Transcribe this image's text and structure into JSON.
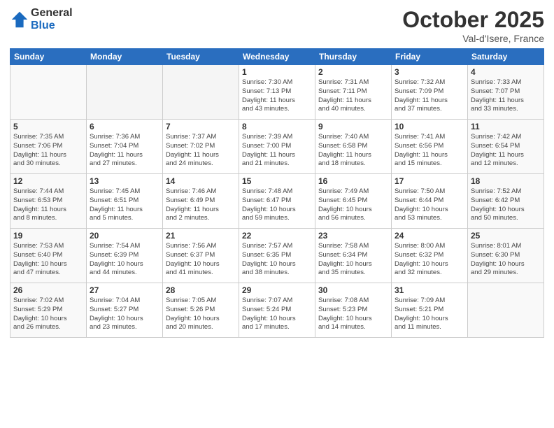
{
  "header": {
    "logo_general": "General",
    "logo_blue": "Blue",
    "month_title": "October 2025",
    "location": "Val-d'Isere, France"
  },
  "weekdays": [
    "Sunday",
    "Monday",
    "Tuesday",
    "Wednesday",
    "Thursday",
    "Friday",
    "Saturday"
  ],
  "weeks": [
    [
      {
        "day": "",
        "info": ""
      },
      {
        "day": "",
        "info": ""
      },
      {
        "day": "",
        "info": ""
      },
      {
        "day": "1",
        "info": "Sunrise: 7:30 AM\nSunset: 7:13 PM\nDaylight: 11 hours\nand 43 minutes."
      },
      {
        "day": "2",
        "info": "Sunrise: 7:31 AM\nSunset: 7:11 PM\nDaylight: 11 hours\nand 40 minutes."
      },
      {
        "day": "3",
        "info": "Sunrise: 7:32 AM\nSunset: 7:09 PM\nDaylight: 11 hours\nand 37 minutes."
      },
      {
        "day": "4",
        "info": "Sunrise: 7:33 AM\nSunset: 7:07 PM\nDaylight: 11 hours\nand 33 minutes."
      }
    ],
    [
      {
        "day": "5",
        "info": "Sunrise: 7:35 AM\nSunset: 7:06 PM\nDaylight: 11 hours\nand 30 minutes."
      },
      {
        "day": "6",
        "info": "Sunrise: 7:36 AM\nSunset: 7:04 PM\nDaylight: 11 hours\nand 27 minutes."
      },
      {
        "day": "7",
        "info": "Sunrise: 7:37 AM\nSunset: 7:02 PM\nDaylight: 11 hours\nand 24 minutes."
      },
      {
        "day": "8",
        "info": "Sunrise: 7:39 AM\nSunset: 7:00 PM\nDaylight: 11 hours\nand 21 minutes."
      },
      {
        "day": "9",
        "info": "Sunrise: 7:40 AM\nSunset: 6:58 PM\nDaylight: 11 hours\nand 18 minutes."
      },
      {
        "day": "10",
        "info": "Sunrise: 7:41 AM\nSunset: 6:56 PM\nDaylight: 11 hours\nand 15 minutes."
      },
      {
        "day": "11",
        "info": "Sunrise: 7:42 AM\nSunset: 6:54 PM\nDaylight: 11 hours\nand 12 minutes."
      }
    ],
    [
      {
        "day": "12",
        "info": "Sunrise: 7:44 AM\nSunset: 6:53 PM\nDaylight: 11 hours\nand 8 minutes."
      },
      {
        "day": "13",
        "info": "Sunrise: 7:45 AM\nSunset: 6:51 PM\nDaylight: 11 hours\nand 5 minutes."
      },
      {
        "day": "14",
        "info": "Sunrise: 7:46 AM\nSunset: 6:49 PM\nDaylight: 11 hours\nand 2 minutes."
      },
      {
        "day": "15",
        "info": "Sunrise: 7:48 AM\nSunset: 6:47 PM\nDaylight: 10 hours\nand 59 minutes."
      },
      {
        "day": "16",
        "info": "Sunrise: 7:49 AM\nSunset: 6:45 PM\nDaylight: 10 hours\nand 56 minutes."
      },
      {
        "day": "17",
        "info": "Sunrise: 7:50 AM\nSunset: 6:44 PM\nDaylight: 10 hours\nand 53 minutes."
      },
      {
        "day": "18",
        "info": "Sunrise: 7:52 AM\nSunset: 6:42 PM\nDaylight: 10 hours\nand 50 minutes."
      }
    ],
    [
      {
        "day": "19",
        "info": "Sunrise: 7:53 AM\nSunset: 6:40 PM\nDaylight: 10 hours\nand 47 minutes."
      },
      {
        "day": "20",
        "info": "Sunrise: 7:54 AM\nSunset: 6:39 PM\nDaylight: 10 hours\nand 44 minutes."
      },
      {
        "day": "21",
        "info": "Sunrise: 7:56 AM\nSunset: 6:37 PM\nDaylight: 10 hours\nand 41 minutes."
      },
      {
        "day": "22",
        "info": "Sunrise: 7:57 AM\nSunset: 6:35 PM\nDaylight: 10 hours\nand 38 minutes."
      },
      {
        "day": "23",
        "info": "Sunrise: 7:58 AM\nSunset: 6:34 PM\nDaylight: 10 hours\nand 35 minutes."
      },
      {
        "day": "24",
        "info": "Sunrise: 8:00 AM\nSunset: 6:32 PM\nDaylight: 10 hours\nand 32 minutes."
      },
      {
        "day": "25",
        "info": "Sunrise: 8:01 AM\nSunset: 6:30 PM\nDaylight: 10 hours\nand 29 minutes."
      }
    ],
    [
      {
        "day": "26",
        "info": "Sunrise: 7:02 AM\nSunset: 5:29 PM\nDaylight: 10 hours\nand 26 minutes."
      },
      {
        "day": "27",
        "info": "Sunrise: 7:04 AM\nSunset: 5:27 PM\nDaylight: 10 hours\nand 23 minutes."
      },
      {
        "day": "28",
        "info": "Sunrise: 7:05 AM\nSunset: 5:26 PM\nDaylight: 10 hours\nand 20 minutes."
      },
      {
        "day": "29",
        "info": "Sunrise: 7:07 AM\nSunset: 5:24 PM\nDaylight: 10 hours\nand 17 minutes."
      },
      {
        "day": "30",
        "info": "Sunrise: 7:08 AM\nSunset: 5:23 PM\nDaylight: 10 hours\nand 14 minutes."
      },
      {
        "day": "31",
        "info": "Sunrise: 7:09 AM\nSunset: 5:21 PM\nDaylight: 10 hours\nand 11 minutes."
      },
      {
        "day": "",
        "info": ""
      }
    ]
  ]
}
